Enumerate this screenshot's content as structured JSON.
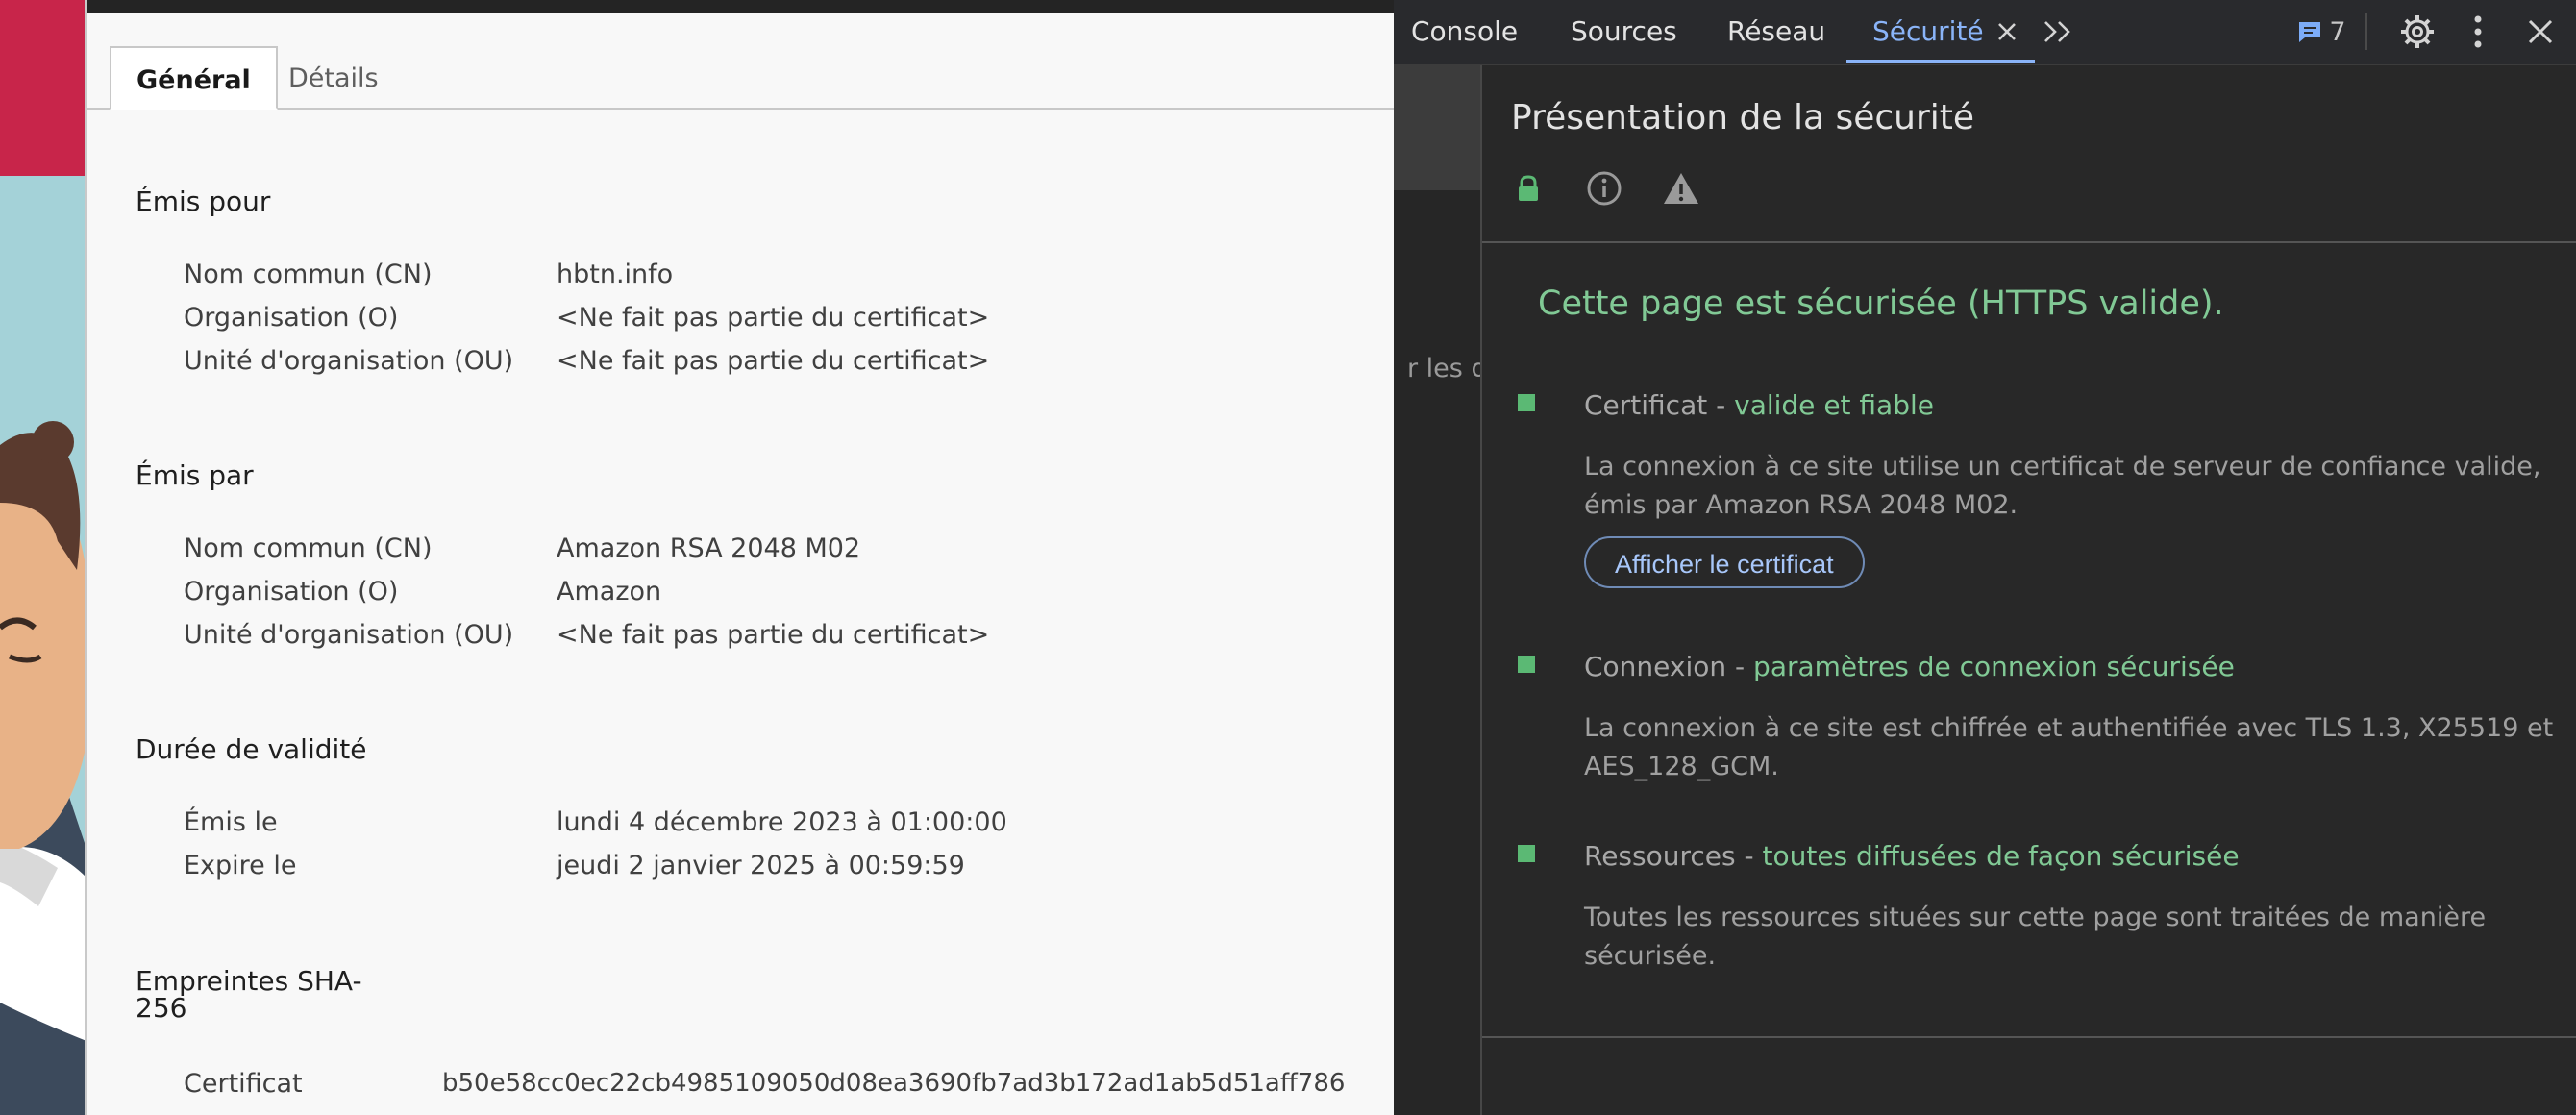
{
  "colors": {
    "devtools_bg": "#282828",
    "accent_blue": "#8ab4f8",
    "secure_green": "#81c995",
    "dialog_bg": "#f8f8f8"
  },
  "certificate_viewer": {
    "tabs": [
      {
        "label": "Général",
        "active": true
      },
      {
        "label": "Détails",
        "active": false
      }
    ],
    "issued_to": {
      "title": "Émis pour",
      "rows": [
        {
          "label": "Nom commun (CN)",
          "value": "hbtn.info"
        },
        {
          "label": "Organisation (O)",
          "value": "<Ne fait pas partie du certificat>"
        },
        {
          "label": "Unité d'organisation (OU)",
          "value": "<Ne fait pas partie du certificat>"
        }
      ]
    },
    "issued_by": {
      "title": "Émis par",
      "rows": [
        {
          "label": "Nom commun (CN)",
          "value": "Amazon RSA 2048 M02"
        },
        {
          "label": "Organisation (O)",
          "value": "Amazon"
        },
        {
          "label": "Unité d'organisation (OU)",
          "value": "<Ne fait pas partie du certificat>"
        }
      ]
    },
    "validity": {
      "title": "Durée de validité",
      "rows": [
        {
          "label": "Émis le",
          "value": "lundi 4 décembre 2023 à 01:00:00"
        },
        {
          "label": "Expire le",
          "value": "jeudi 2 janvier 2025 à 00:59:59"
        }
      ]
    },
    "fingerprints": {
      "title_line1": "Empreintes SHA-",
      "title_line2": "256",
      "rows": [
        {
          "label": "Certificat",
          "value": "b50e58cc0ec22cb4985109050d08ea3690fb7ad3b172ad1ab5d51aff786"
        }
      ]
    }
  },
  "devtools": {
    "tabs": [
      {
        "label": "Console",
        "active": false
      },
      {
        "label": "Sources",
        "active": false
      },
      {
        "label": "Réseau",
        "active": false
      },
      {
        "label": "Sécurité",
        "active": true
      }
    ],
    "icons": [
      "close-tab-icon",
      "more-tabs-icon",
      "issues-icon",
      "settings-icon",
      "kebab-menu-icon",
      "close-icon"
    ],
    "issues_count": "7",
    "left_panel_text": "r les dé",
    "security": {
      "title": "Présentation de la sécurité",
      "status_icons": [
        "lock-icon",
        "info-icon",
        "warning-icon"
      ],
      "heading": "Cette page est sécurisée (HTTPS valide).",
      "items": [
        {
          "name": "Certificat",
          "separator": " - ",
          "status": "valide et fiable",
          "description": "La connexion à ce site utilise un certificat de serveur de confiance valide, émis par Amazon RSA 2048 M02.",
          "button": "Afficher le certificat"
        },
        {
          "name": "Connexion",
          "separator": " - ",
          "status": "paramètres de connexion sécurisée",
          "description": "La connexion à ce site est chiffrée et authentifiée avec TLS 1.3, X25519 et AES_128_GCM."
        },
        {
          "name": "Ressources",
          "separator": " - ",
          "status": "toutes diffusées de façon sécurisée",
          "description": "Toutes les ressources situées sur cette page sont traitées de manière sécurisée."
        }
      ]
    }
  }
}
